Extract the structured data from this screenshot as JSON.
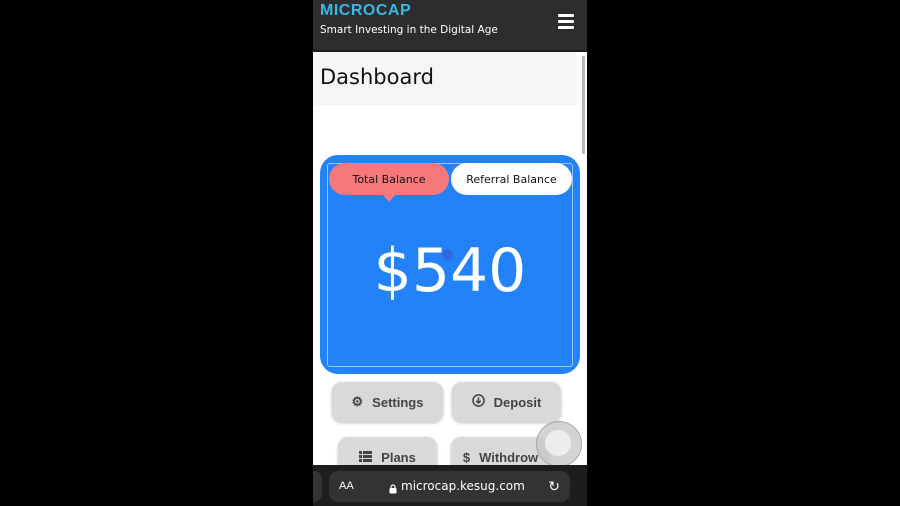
{
  "header": {
    "brand": "MICROCAP",
    "tagline": "Smart Investing in the Digital Age"
  },
  "page": {
    "title": "Dashboard"
  },
  "balance_card": {
    "tabs": [
      {
        "label": "Total Balance",
        "active": true
      },
      {
        "label": "Referral Balance",
        "active": false
      }
    ],
    "amount": "$540"
  },
  "actions": {
    "settings": {
      "label": "Settings",
      "icon": "gear-icon"
    },
    "deposit": {
      "label": "Deposit",
      "icon": "download-circle-icon"
    },
    "plans": {
      "label": "Plans",
      "icon": "list-icon"
    },
    "withdraw": {
      "label": "Withdrow",
      "icon": "dollar-icon"
    }
  },
  "browser": {
    "text_size": "AA",
    "url": "microcap.kesug.com"
  },
  "colors": {
    "header_bg": "#2d2d30",
    "brand": "#39b8e0",
    "card": "#2482f9",
    "active_tab": "#f7787b"
  }
}
